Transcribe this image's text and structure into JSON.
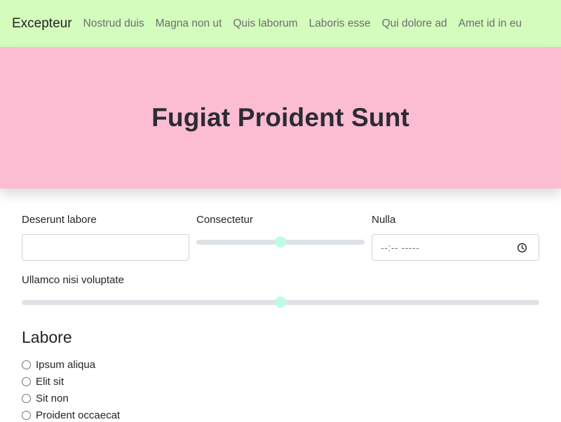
{
  "navbar": {
    "brand": "Excepteur",
    "links": [
      "Nostrud duis",
      "Magna non ut",
      "Quis laborum",
      "Laboris esse",
      "Qui dolore ad",
      "Amet id in eu"
    ],
    "background": "#d4fcbc"
  },
  "hero": {
    "title": "Fugiat Proident Sunt",
    "background": "#fcbcd2"
  },
  "form": {
    "field1": {
      "label": "Deserunt labore",
      "value": ""
    },
    "range1": {
      "label": "Consectetur",
      "value_fraction": 0.5
    },
    "time_field": {
      "label": "Nulla",
      "placeholder": "--:-- -----",
      "icon": "clock-icon"
    },
    "range2": {
      "label": "Ullamco nisi voluptate",
      "value_fraction": 0.5
    },
    "accent": "#bcfce6"
  },
  "radio_group": {
    "title": "Labore",
    "options": [
      "Ipsum aliqua",
      "Elit sit",
      "Sit non",
      "Proident occaecat"
    ]
  }
}
